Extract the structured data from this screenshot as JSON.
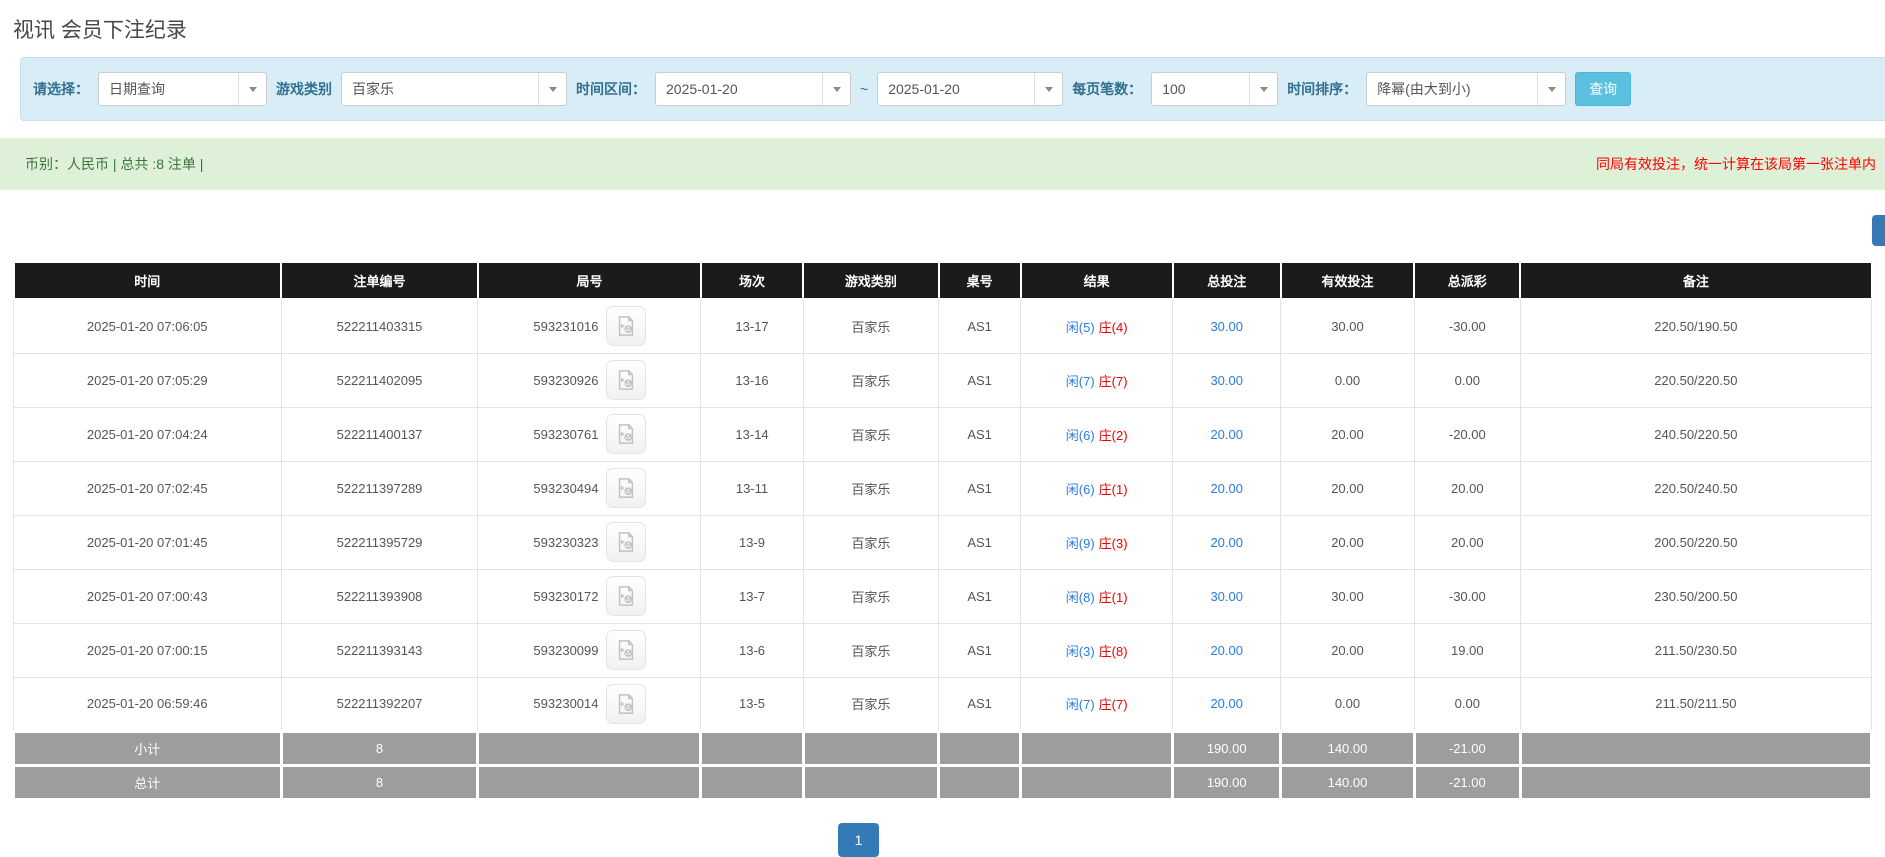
{
  "page": {
    "title": "视讯 会员下注纪录"
  },
  "filter_bar": {
    "select_label": "请选择：",
    "select_value": "日期查询",
    "game_label": "游戏类别",
    "game_value": "百家乐",
    "range_label": "时间区间：",
    "date_from": "2025-01-20",
    "tilde": "~",
    "date_to": "2025-01-20",
    "page_size_label": "每页笔数：",
    "page_size_value": "100",
    "sort_label": "时间排序：",
    "sort_value": "降幂(由大到小)",
    "search_label": "查询"
  },
  "summary_bar": {
    "left": "币别：人民币 | 总共 :8 注单 |",
    "right": "同局有效投注，统一计算在该局第一张注单内"
  },
  "table": {
    "headers": [
      "时间",
      "注单编号",
      "局号",
      "场次",
      "游戏类别",
      "桌号",
      "结果",
      "总投注",
      "有效投注",
      "总派彩",
      "备注"
    ],
    "rows": [
      {
        "time": "2025-01-20 07:06:05",
        "bet_id": "522211403315",
        "round_id": "593231016",
        "session": "13-17",
        "game": "百家乐",
        "table_no": "AS1",
        "player": "闲(5)",
        "banker": "庄(4)",
        "total_bet": "30.00",
        "valid_bet": "30.00",
        "payout": "-30.00",
        "note": "220.50/190.50"
      },
      {
        "time": "2025-01-20 07:05:29",
        "bet_id": "522211402095",
        "round_id": "593230926",
        "session": "13-16",
        "game": "百家乐",
        "table_no": "AS1",
        "player": "闲(7)",
        "banker": "庄(7)",
        "total_bet": "30.00",
        "valid_bet": "0.00",
        "payout": "0.00",
        "note": "220.50/220.50"
      },
      {
        "time": "2025-01-20 07:04:24",
        "bet_id": "522211400137",
        "round_id": "593230761",
        "session": "13-14",
        "game": "百家乐",
        "table_no": "AS1",
        "player": "闲(6)",
        "banker": "庄(2)",
        "total_bet": "20.00",
        "valid_bet": "20.00",
        "payout": "-20.00",
        "note": "240.50/220.50"
      },
      {
        "time": "2025-01-20 07:02:45",
        "bet_id": "522211397289",
        "round_id": "593230494",
        "session": "13-11",
        "game": "百家乐",
        "table_no": "AS1",
        "player": "闲(6)",
        "banker": "庄(1)",
        "total_bet": "20.00",
        "valid_bet": "20.00",
        "payout": "20.00",
        "note": "220.50/240.50"
      },
      {
        "time": "2025-01-20 07:01:45",
        "bet_id": "522211395729",
        "round_id": "593230323",
        "session": "13-9",
        "game": "百家乐",
        "table_no": "AS1",
        "player": "闲(9)",
        "banker": "庄(3)",
        "total_bet": "20.00",
        "valid_bet": "20.00",
        "payout": "20.00",
        "note": "200.50/220.50"
      },
      {
        "time": "2025-01-20 07:00:43",
        "bet_id": "522211393908",
        "round_id": "593230172",
        "session": "13-7",
        "game": "百家乐",
        "table_no": "AS1",
        "player": "闲(8)",
        "banker": "庄(1)",
        "total_bet": "30.00",
        "valid_bet": "30.00",
        "payout": "-30.00",
        "note": "230.50/200.50"
      },
      {
        "time": "2025-01-20 07:00:15",
        "bet_id": "522211393143",
        "round_id": "593230099",
        "session": "13-6",
        "game": "百家乐",
        "table_no": "AS1",
        "player": "闲(3)",
        "banker": "庄(8)",
        "total_bet": "20.00",
        "valid_bet": "20.00",
        "payout": "19.00",
        "note": "211.50/230.50"
      },
      {
        "time": "2025-01-20 06:59:46",
        "bet_id": "522211392207",
        "round_id": "593230014",
        "session": "13-5",
        "game": "百家乐",
        "table_no": "AS1",
        "player": "闲(7)",
        "banker": "庄(7)",
        "total_bet": "20.00",
        "valid_bet": "0.00",
        "payout": "0.00",
        "note": "211.50/211.50"
      }
    ],
    "footer": [
      {
        "label": "小计",
        "count": "8",
        "total_bet": "190.00",
        "valid_bet": "140.00",
        "payout": "-21.00"
      },
      {
        "label": "总计",
        "count": "8",
        "total_bet": "190.00",
        "valid_bet": "140.00",
        "payout": "-21.00"
      }
    ]
  },
  "pagination": {
    "current": "1"
  },
  "colors": {
    "info_bar_bg": "#d9edf7",
    "info_text": "#31708f",
    "search_btn": "#5bc0de",
    "success_bg": "#dff0d8",
    "success_text": "#3c763d",
    "note_red": "#fb0000",
    "header_bg": "#1b1b1b",
    "footer_bg": "#9d9d9d",
    "link_blue": "#2a7ce0",
    "negative_red": "#ea0000",
    "accent_blue": "#337ab7"
  }
}
